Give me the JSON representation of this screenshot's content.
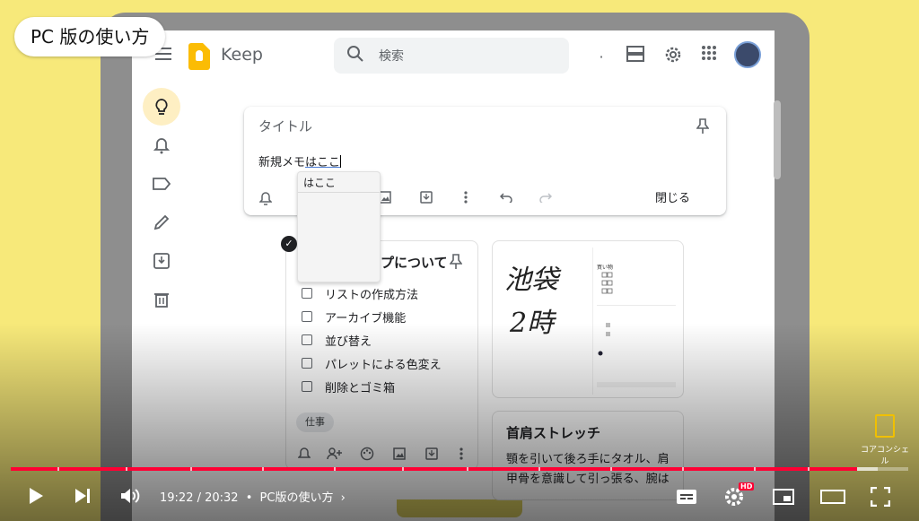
{
  "overlay_title": "PC 版の使い方",
  "header": {
    "app_name": "Keep",
    "search_placeholder": "検索",
    "dot": "·"
  },
  "composer": {
    "title_placeholder": "タイトル",
    "body_prefix": "新規メモ",
    "body_composing": "はここ",
    "close_label": "閉じる"
  },
  "ime": {
    "candidate": "はここ"
  },
  "note1": {
    "title_partial": "プについて",
    "items": [
      "リストの作成方法",
      "アーカイブ機能",
      "並び替え",
      "パレットによる色変え",
      "削除とゴミ箱"
    ],
    "label": "仕事"
  },
  "note2": {
    "handwriting": [
      "池袋",
      "2時"
    ],
    "phone_list_title": "買い物"
  },
  "note3": {
    "title": "首肩ストレッチ",
    "body": "顎を引いて後ろ手にタオル、肩甲骨を意識して引っ張る、腕は"
  },
  "player": {
    "time": "19:22 / 20:32",
    "separator": "•",
    "chapter": "PC版の使い方",
    "progress_fraction": 0.943,
    "hd_badge": "HD",
    "accent": "#ff0033"
  },
  "watermark": "コアコンシェル",
  "icons": [
    "menu-icon",
    "search-icon",
    "list-view-icon",
    "settings-icon",
    "apps-icon",
    "bulb-icon",
    "bell-icon",
    "label-icon",
    "pencil-icon",
    "archive-icon",
    "trash-icon",
    "pin-icon",
    "reminder-icon",
    "collaborator-icon",
    "palette-icon",
    "image-icon",
    "more-icon",
    "undo-icon",
    "redo-icon",
    "play-icon",
    "next-icon",
    "volume-icon",
    "subtitles-icon",
    "miniplayer-icon",
    "theater-icon",
    "fullscreen-icon"
  ]
}
